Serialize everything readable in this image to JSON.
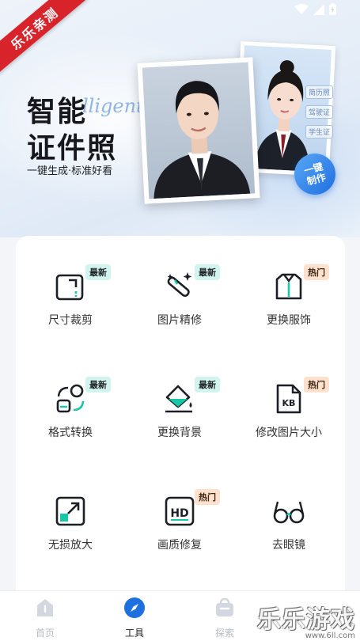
{
  "status_bar": {
    "icons": [
      "wifi-icon",
      "signal-icon",
      "battery-icon"
    ]
  },
  "hero": {
    "ribbon": "乐乐亲测",
    "title_line1": "智能",
    "title_script": "lligent",
    "title_line2": "证件照",
    "subtitle": "一键生成·标准好看",
    "tags": [
      "简历照",
      "驾驶证",
      "学生证"
    ],
    "badge_line1": "一键",
    "badge_line2": "制作"
  },
  "tools": [
    {
      "label": "尺寸裁剪",
      "tag": "最新",
      "tag_type": "new",
      "icon": "crop-icon"
    },
    {
      "label": "图片精修",
      "tag": "最新",
      "tag_type": "new",
      "icon": "magic-wand-icon"
    },
    {
      "label": "更换服饰",
      "tag": "热门",
      "tag_type": "hot",
      "icon": "shirt-icon"
    },
    {
      "label": "格式转换",
      "tag": "最新",
      "tag_type": "new",
      "icon": "format-convert-icon"
    },
    {
      "label": "更换背景",
      "tag": "最新",
      "tag_type": "new",
      "icon": "paint-bucket-icon"
    },
    {
      "label": "修改图片大小",
      "tag": "热门",
      "tag_type": "hot",
      "icon": "kb-file-icon"
    },
    {
      "label": "无损放大",
      "tag": "",
      "tag_type": "",
      "icon": "enlarge-icon"
    },
    {
      "label": "画质修复",
      "tag": "热门",
      "tag_type": "hot",
      "icon": "hd-icon"
    },
    {
      "label": "去眼镜",
      "tag": "",
      "tag_type": "",
      "icon": "glasses-icon"
    }
  ],
  "tabbar": {
    "items": [
      {
        "label": "首页",
        "icon": "home-icon",
        "active": false
      },
      {
        "label": "工具",
        "icon": "compass-icon",
        "active": true
      },
      {
        "label": "探索",
        "icon": "bag-icon",
        "active": false
      }
    ]
  },
  "watermark": {
    "title": "乐乐游戏",
    "url": "www.6ll.com"
  },
  "colors": {
    "accent": "#1e6fe0",
    "new_tag": "#d2f4ee",
    "hot_tag": "#ffe1cd",
    "ribbon": "#d8232a"
  }
}
